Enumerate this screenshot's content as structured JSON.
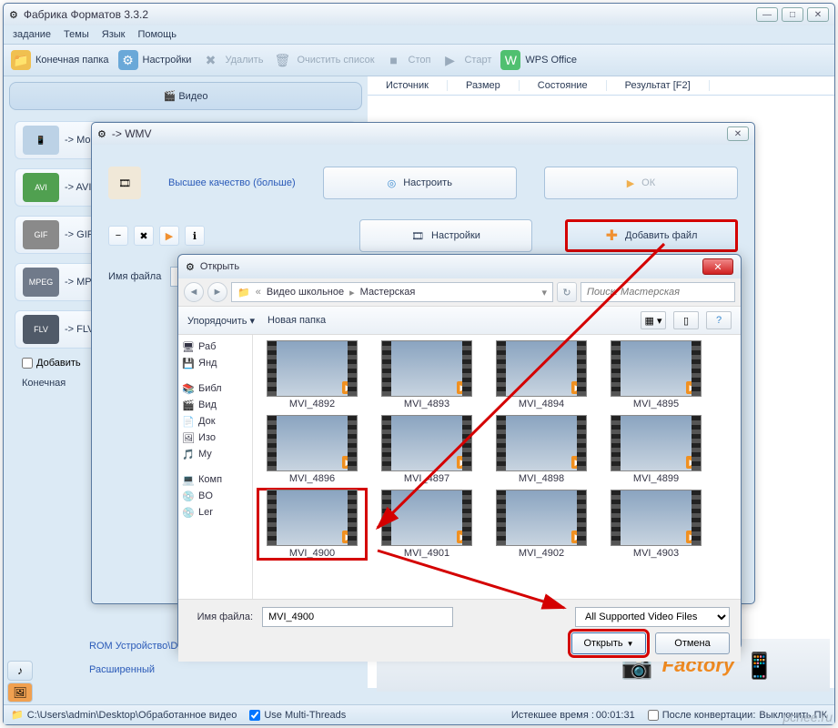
{
  "app": {
    "title": "Фабрика Форматов 3.3.2",
    "menubar": [
      "задание",
      "Темы",
      "Язык",
      "Помощь"
    ],
    "toolbar": {
      "folder": "Конечная папка",
      "settings": "Настройки",
      "delete": "Удалить",
      "clear": "Очистить список",
      "stop": "Стоп",
      "start": "Старт",
      "wps": "WPS Office"
    },
    "columns": [
      "Источник",
      "Размер",
      "Состояние",
      "Результат [F2]"
    ],
    "video_header": "Видео",
    "formats": [
      {
        "label": "-> Мобильн"
      },
      {
        "label": "-> AVI",
        "badge": "AVI"
      },
      {
        "label": "-> GIF",
        "badge": "GIF"
      },
      {
        "label": "-> MPG",
        "badge": "MPEG"
      },
      {
        "label": "-> FLV",
        "badge": "FLV"
      }
    ],
    "addcheck": "Добавить",
    "finalfolder_label": "Конечная",
    "sidelinks": {
      "rom": "ROM Устройство\\DVD\\CD\\ISO",
      "advanced": "Расширенный"
    },
    "status": {
      "path": "C:\\Users\\admin\\Desktop\\Обработанное видео",
      "mt_label": "Use Multi-Threads",
      "elapsed_label": "Истекшее время :",
      "elapsed": "00:01:31",
      "after_label": "После конвертации:",
      "after_value": "Выключить ПК"
    },
    "banner": "Factory"
  },
  "wmv": {
    "title": "-> WMV",
    "quality": "Высшее качество (больше)",
    "configure": "Настроить",
    "ok": "ОК",
    "settings": "Настройки",
    "add": "Добавить файл",
    "filename_label": "Имя файла"
  },
  "open": {
    "title": "Открыть",
    "organize": "Упорядочить",
    "newfolder": "Новая папка",
    "breadcrumb": [
      "Видео школьное",
      "Мастерская"
    ],
    "search_placeholder": "Поиск: Мастерская",
    "tree": [
      "Раб",
      "Янд",
      "Библ",
      "Вид",
      "Док",
      "Изо",
      "Му",
      "Комп",
      "BO",
      "Ler"
    ],
    "files": [
      "MVI_4892",
      "MVI_4893",
      "MVI_4894",
      "MVI_4895",
      "MVI_4896",
      "MVI_4897",
      "MVI_4898",
      "MVI_4899",
      "MVI_4900",
      "MVI_4901",
      "MVI_4902",
      "MVI_4903"
    ],
    "selected": "MVI_4900",
    "filename_label": "Имя файла:",
    "filename_value": "MVI_4900",
    "filter": "All Supported Video Files",
    "open_btn": "Открыть",
    "cancel_btn": "Отмена"
  },
  "watermark": "pchee.ru"
}
